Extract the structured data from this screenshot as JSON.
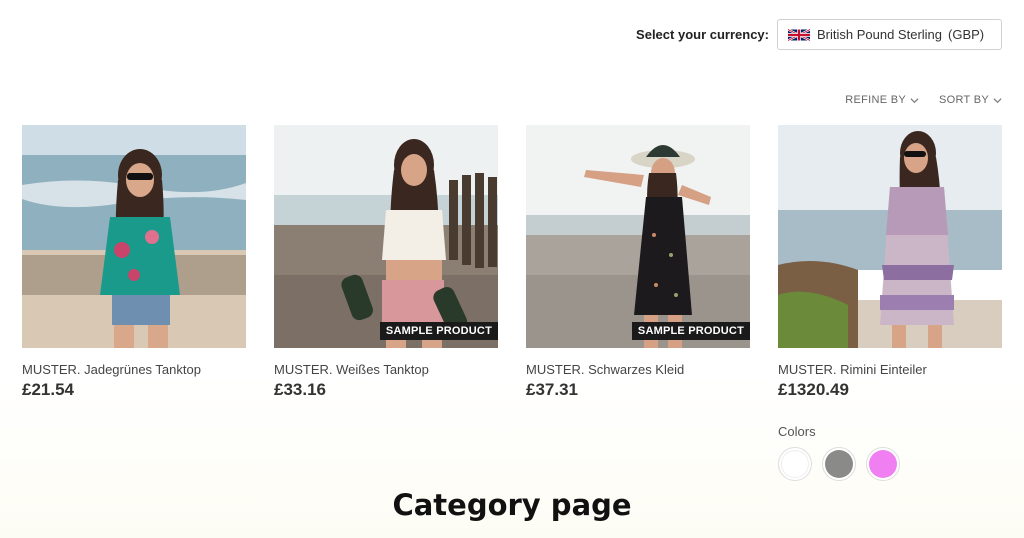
{
  "currency": {
    "label": "Select your currency:",
    "selected_name": "British Pound Sterling",
    "selected_code": "(GBP)",
    "flag_icon": "uk-flag-icon"
  },
  "filters": {
    "refine_label": "REFINE BY",
    "sort_label": "SORT BY"
  },
  "products": [
    {
      "name": "MUSTER. Jadegrünes Tanktop",
      "price": "£21.54",
      "badge": ""
    },
    {
      "name": "MUSTER. Weißes Tanktop",
      "price": "£33.16",
      "badge": "SAMPLE PRODUCT"
    },
    {
      "name": "MUSTER. Schwarzes Kleid",
      "price": "£37.31",
      "badge": "SAMPLE PRODUCT"
    },
    {
      "name": "MUSTER. Rimini Einteiler",
      "price": "£1320.49",
      "badge": ""
    }
  ],
  "colors": {
    "label": "Colors",
    "swatches": [
      "#ffffff",
      "#8a8a88",
      "#f07ff2"
    ]
  },
  "caption": "Category page"
}
